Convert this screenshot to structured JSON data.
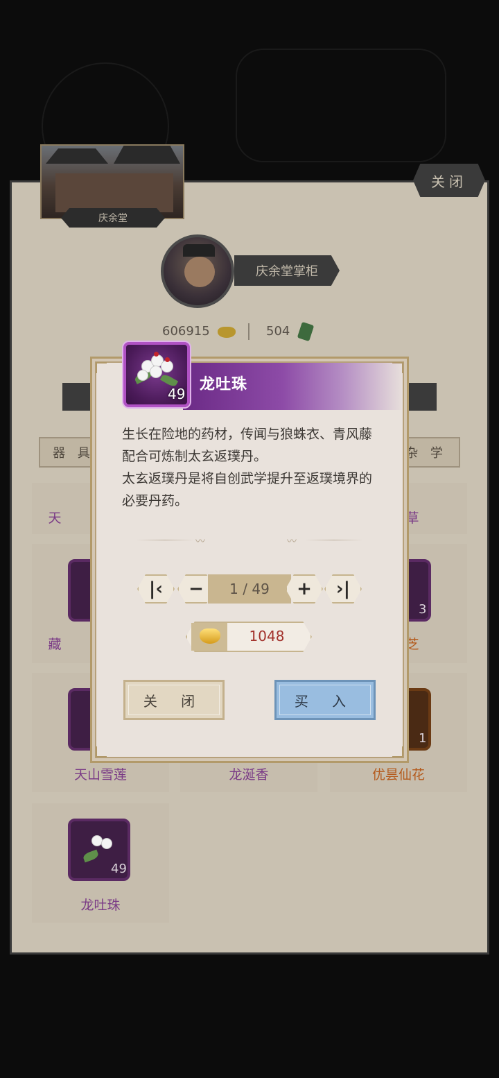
{
  "background": {
    "panel_close_label": "关闭",
    "shop_name": "庆余堂",
    "keeper_title": "庆余堂掌柜",
    "gold_amount": "606915",
    "jade_amount": "504",
    "tabs": {
      "left": "器 具",
      "right": "杂 学"
    },
    "grid_items": [
      {
        "name": "天",
        "count": ""
      },
      {
        "name": "草",
        "count": ""
      },
      {
        "name": "藏",
        "count": ""
      },
      {
        "name": "芝",
        "count": "3"
      },
      {
        "name": "天山雪莲",
        "count": ""
      },
      {
        "name": "龙涎香",
        "count": ""
      },
      {
        "name": "优昙仙花",
        "count": "1"
      },
      {
        "name": "龙吐珠",
        "count": "49"
      }
    ],
    "colors": {
      "purple_name": "#7a3a86",
      "orange_name": "#b45a1c"
    }
  },
  "modal": {
    "title": "龙吐珠",
    "icon": "flower-icon",
    "icon_count": "49",
    "description": [
      "生长在险地的药材，传闻与狼蛛衣、青风藤配合可炼制太玄返璞丹。",
      "太玄返璞丹是将自创武学提升至返璞境界的必要丹药。"
    ],
    "stepper": {
      "quantity": "1 / 49",
      "first_icon": "skip-to-first-icon",
      "minus_icon": "minus-icon",
      "plus_icon": "plus-icon",
      "last_icon": "skip-to-last-icon"
    },
    "price": {
      "icon": "gold-ingot-icon",
      "value": "1048"
    },
    "buttons": {
      "close": "关 闭",
      "buy": "买 入"
    },
    "colors": {
      "title_bar": "#7a3690",
      "buy_button": "#99bde0",
      "price_text": "#a2312b"
    }
  }
}
